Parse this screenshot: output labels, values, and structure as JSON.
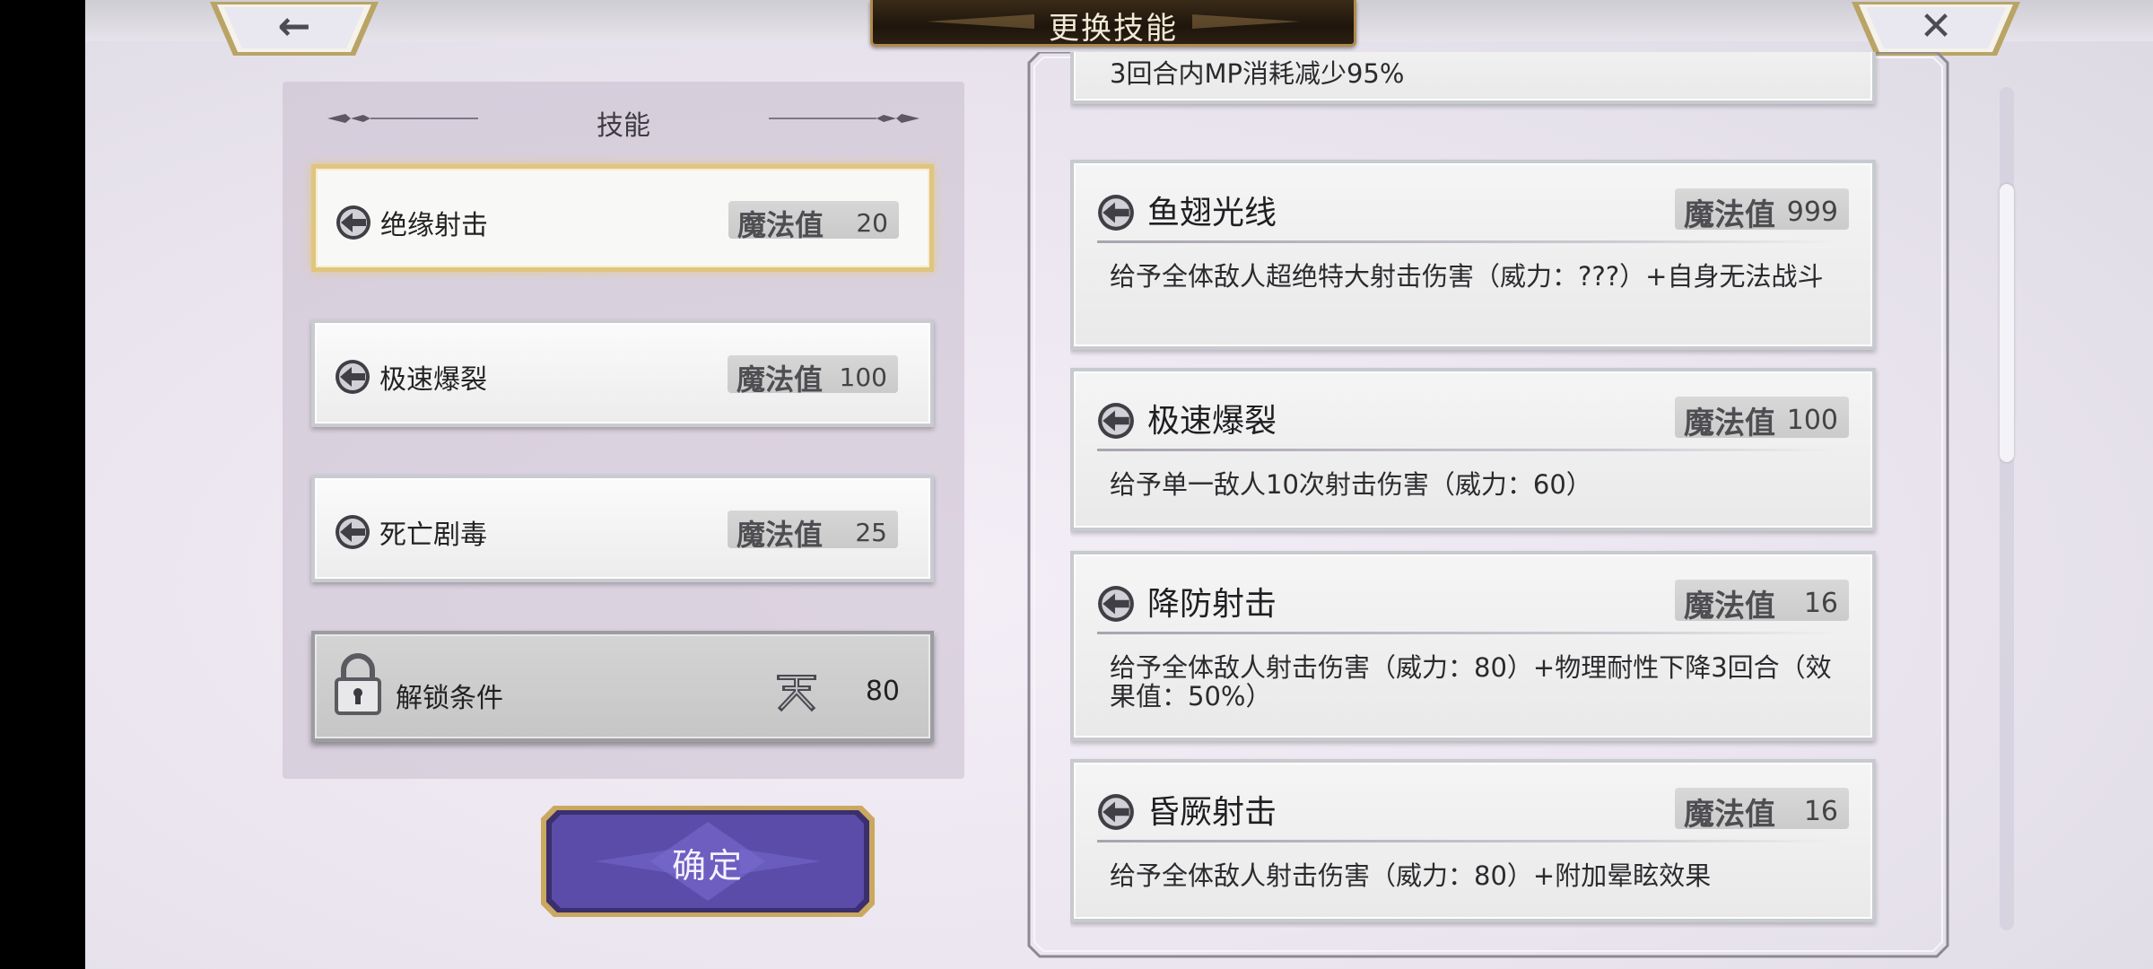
{
  "header": {
    "title": "更换技能",
    "back_icon": "arrow-left-icon",
    "close_icon": "close-x-icon"
  },
  "left_panel": {
    "heading": "技能",
    "slots": [
      {
        "name": "绝缘射击",
        "mp_label": "魔法值",
        "mp": "20",
        "selected": true,
        "icon": "skill-arrow-icon"
      },
      {
        "name": "极速爆裂",
        "mp_label": "魔法值",
        "mp": "100",
        "selected": false,
        "icon": "skill-arrow-icon"
      },
      {
        "name": "死亡剧毒",
        "mp_label": "魔法值",
        "mp": "25",
        "selected": false,
        "icon": "skill-arrow-icon"
      }
    ],
    "locked_slot": {
      "label": "解锁条件",
      "requirement_value": "80",
      "icon": "lock-icon",
      "requirement_icon": "rank-glyph-icon"
    },
    "confirm_label": "确定"
  },
  "skill_list": {
    "partial_card_desc": "3回合内MP消耗减少95%",
    "cards": [
      {
        "name": "鱼翅光线",
        "mp_label": "魔法值",
        "mp": "999",
        "desc": "给予全体敌人超绝特大射击伤害（威力：???）+自身无法战斗"
      },
      {
        "name": "极速爆裂",
        "mp_label": "魔法值",
        "mp": "100",
        "desc": "给予单一敌人10次射击伤害（威力：60）"
      },
      {
        "name": "降防射击",
        "mp_label": "魔法值",
        "mp": "16",
        "desc": "给予全体敌人射击伤害（威力：80）+物理耐性下降3回合（效果值：50%）"
      },
      {
        "name": "昏厥射击",
        "mp_label": "魔法值",
        "mp": "16",
        "desc": "给予全体敌人射击伤害（威力：80）+附加晕眩效果"
      }
    ]
  },
  "colors": {
    "selected_border": "#e0c57e",
    "plaque_gold": "#b08a4c",
    "confirm_purple": "#4a3d8f"
  }
}
